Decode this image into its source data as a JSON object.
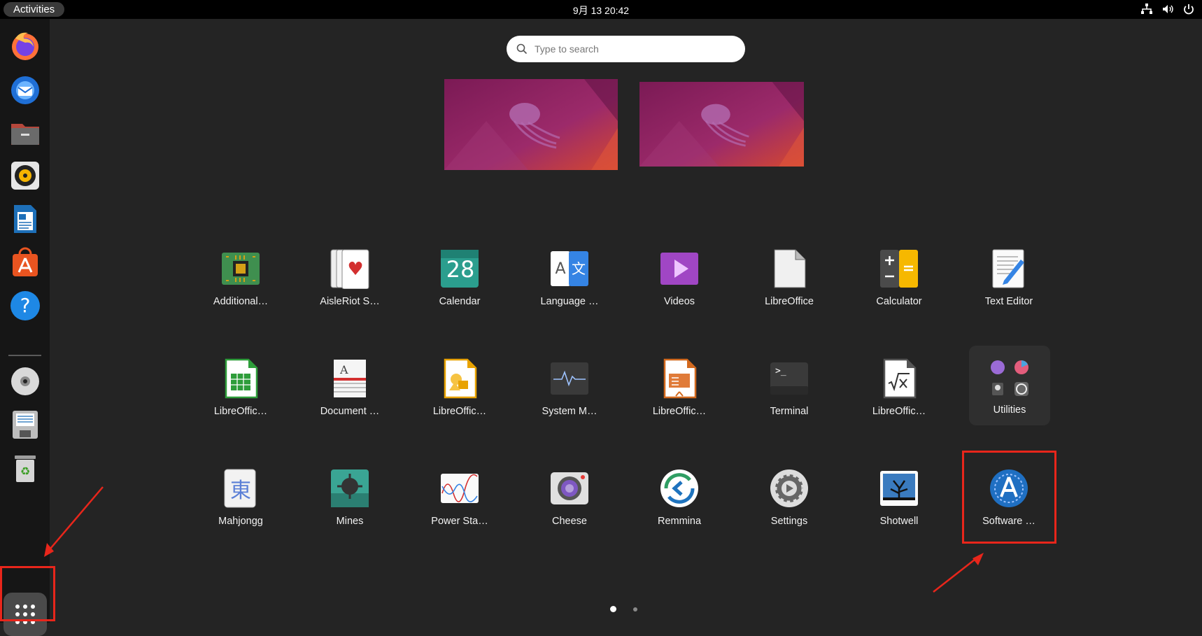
{
  "topbar": {
    "activities_label": "Activities",
    "clock": "9月 13  20:42",
    "tray_icons": [
      "network-icon",
      "volume-icon",
      "power-icon"
    ]
  },
  "dock": {
    "items": [
      {
        "name": "Firefox",
        "icon": "firefox-icon"
      },
      {
        "name": "Thunderbird",
        "icon": "thunderbird-icon"
      },
      {
        "name": "Files",
        "icon": "files-icon"
      },
      {
        "name": "Rhythmbox",
        "icon": "rhythmbox-icon"
      },
      {
        "name": "LibreOffice Writer",
        "icon": "writer-icon"
      },
      {
        "name": "Ubuntu Software",
        "icon": "software-store-icon"
      },
      {
        "name": "Help",
        "icon": "help-icon"
      },
      {
        "name": "Disc",
        "icon": "disc-icon"
      },
      {
        "name": "Save",
        "icon": "floppy-icon"
      },
      {
        "name": "Trash",
        "icon": "trash-icon"
      }
    ],
    "show_apps_icon": "grid-icon"
  },
  "search": {
    "placeholder": "Type to search"
  },
  "apps": {
    "row1": [
      "Additional…",
      "AisleRiot S…",
      "Calendar",
      "Language …",
      "Videos",
      "LibreOffice",
      "Calculator",
      "Text Editor"
    ],
    "row2": [
      "LibreOffic…",
      "Document …",
      "LibreOffic…",
      "System M…",
      "LibreOffic…",
      "Terminal",
      "LibreOffic…",
      "Utilities"
    ],
    "row3": [
      "Mahjongg",
      "Mines",
      "Power Sta…",
      "Cheese",
      "Remmina",
      "Settings",
      "Shotwell",
      "Software …"
    ],
    "calendar_day": "28",
    "mahjongg_glyph": "東",
    "terminal_prompt": ">_",
    "language_letters": [
      "A",
      "文"
    ]
  },
  "pagination": {
    "pages": 2,
    "current": 1
  },
  "colors": {
    "topbar": "#000000",
    "dock": "#161616",
    "background": "#242424",
    "highlight": "#e8261b"
  }
}
